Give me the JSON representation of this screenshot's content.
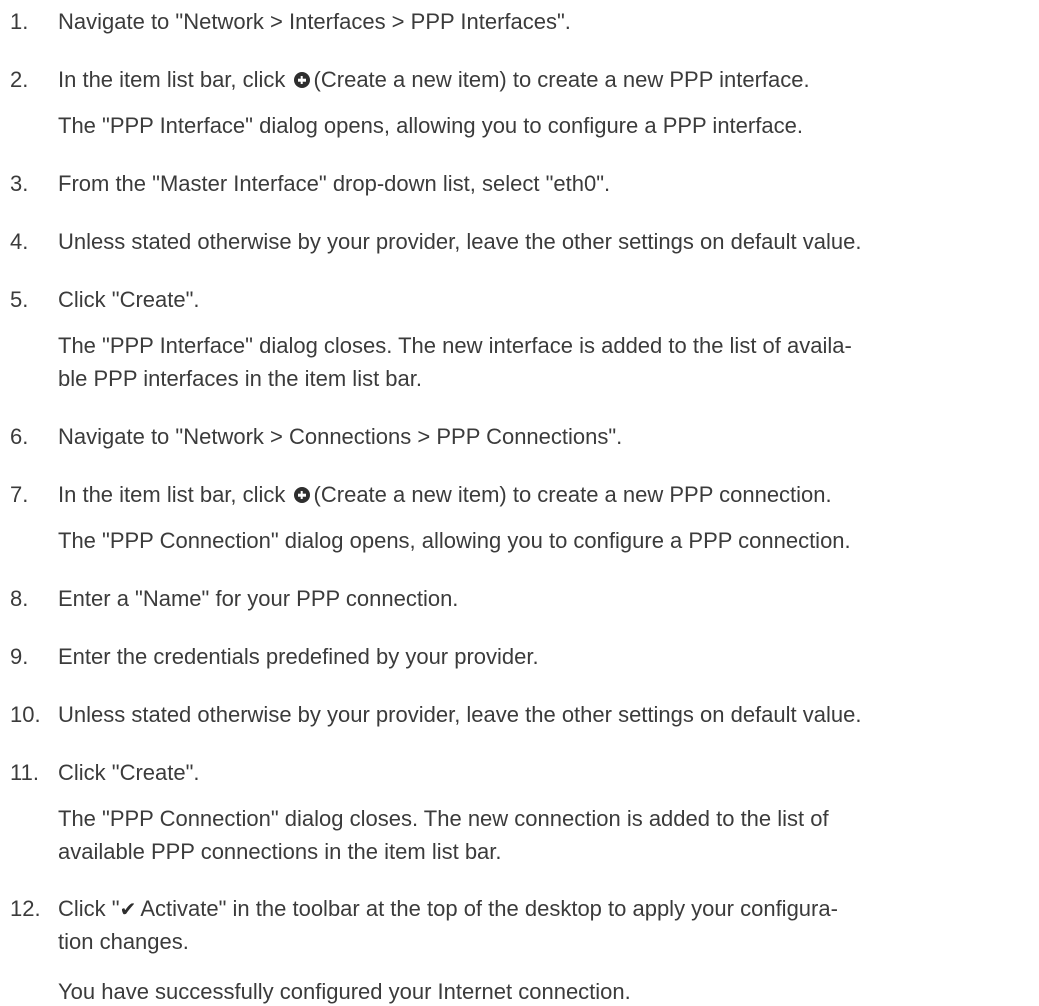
{
  "steps": [
    {
      "num": "1.",
      "text": "Navigate to \"Network > Interfaces > PPP Interfaces\"."
    },
    {
      "num": "2.",
      "text_before": "In the item list bar, click",
      "icon": "plus-circle-icon",
      "text_after": "(Create a new item) to create a new PPP interface.",
      "result": "The \"PPP Interface\" dialog opens, allowing you to configure a PPP interface."
    },
    {
      "num": "3.",
      "text": "From the \"Master Interface\" drop-down list, select \"eth0\"."
    },
    {
      "num": "4.",
      "text": "Unless stated otherwise by your provider, leave the other settings on default value."
    },
    {
      "num": "5.",
      "text": "Click \"Create\".",
      "result_line1": "The \"PPP Interface\" dialog closes. The new interface is added to the list of availa-",
      "result_line2": "ble PPP interfaces in the item list bar."
    },
    {
      "num": "6.",
      "text": "Navigate to \"Network > Connections > PPP Connections\"."
    },
    {
      "num": "7.",
      "text_before": "In the item list bar, click",
      "icon": "plus-circle-icon",
      "text_after": "(Create a new item) to create a new PPP connection.",
      "result": "The \"PPP Connection\" dialog opens, allowing you to configure a PPP connection."
    },
    {
      "num": "8.",
      "text": "Enter a \"Name\" for your PPP connection."
    },
    {
      "num": "9.",
      "text": "Enter the credentials predefined by your provider."
    },
    {
      "num": "10.",
      "text": "Unless stated otherwise by your provider, leave the other settings on default value."
    },
    {
      "num": "11.",
      "text": "Click \"Create\".",
      "result_line1": "The \"PPP Connection\" dialog closes. The new connection is added to the list of",
      "result_line2": "available PPP connections in the item list bar."
    },
    {
      "num": "12.",
      "text_before": "Click \"",
      "icon": "checkmark-icon",
      "text_after": "Activate\" in the toolbar at the top of the desktop to apply your configura-",
      "text_line2": "tion changes.",
      "result": "You have successfully configured your Internet connection."
    }
  ]
}
